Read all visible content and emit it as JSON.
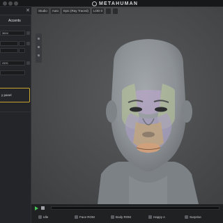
{
  "app": {
    "logo_text": "METAHUMAN"
  },
  "left_panel": {
    "tab_active": "Accents",
    "field_1": "3604",
    "field_2": "ODS",
    "panel_text": "y panel"
  },
  "viewport_toolbar": {
    "items": [
      "Studio",
      "Auto",
      "Epic (Ray Traced)",
      "LOD 0"
    ]
  },
  "animations": {
    "items": [
      "Idle",
      "Face ROM",
      "Body ROM",
      "Happy A",
      "Surprise"
    ]
  },
  "icons": {
    "logo": "metahuman-logo-icon",
    "close": "close-icon",
    "play": "play-icon",
    "stop": "stop-icon"
  },
  "colors": {
    "accent_yellow": "#c8a531",
    "play_green": "#47c45a",
    "background": "#1e1f21"
  }
}
